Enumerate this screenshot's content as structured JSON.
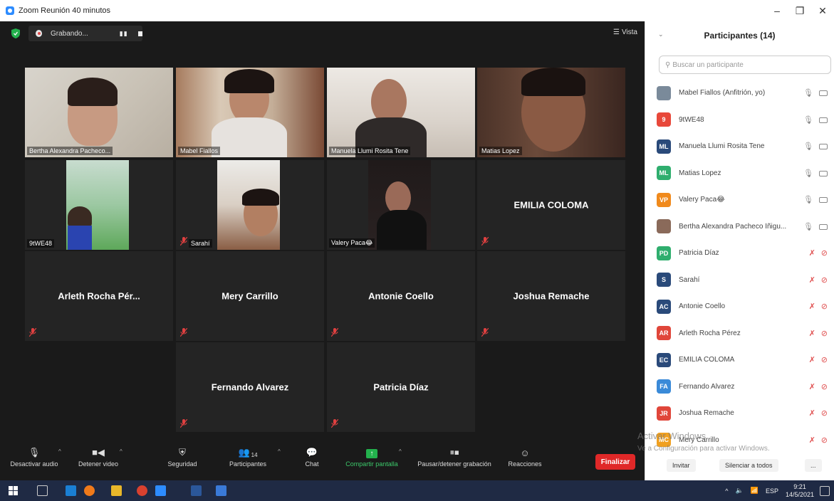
{
  "window": {
    "title": "Zoom Reunión 40 minutos",
    "minimize": "–",
    "restore": "❐",
    "close": "✕"
  },
  "recording": {
    "label": "Grabando...",
    "pause": "▮▮"
  },
  "view": {
    "label": "Vista"
  },
  "tiles": [
    {
      "label": "Bertha Alexandra Pacheco..."
    },
    {
      "label": "Mabel Fiallos"
    },
    {
      "label": "Manuela Llumi Rosita Tene"
    },
    {
      "label": "Matias Lopez"
    },
    {
      "label": "9tWE48"
    },
    {
      "label": "Sarahí"
    },
    {
      "label": "Valery Paca😂"
    },
    {
      "name": "EMILIA COLOMA"
    },
    {
      "name": "Arleth Rocha Pér..."
    },
    {
      "name": "Mery Carrillo"
    },
    {
      "name": "Antonie Coello"
    },
    {
      "name": "Joshua Remache"
    },
    {
      "name": "Fernando Alvarez"
    },
    {
      "name": "Patricia Díaz"
    }
  ],
  "toolbar": {
    "audio": "Desactivar audio",
    "video": "Detener video",
    "security": "Seguridad",
    "participants": "Participantes",
    "participants_count": "14",
    "chat": "Chat",
    "share": "Compartir pantalla",
    "pause_rec": "Pausar/detener grabación",
    "reactions": "Reacciones",
    "end": "Finalizar"
  },
  "panel": {
    "title": "Participantes (14)",
    "search_placeholder": "Buscar un participante",
    "participants": [
      {
        "name": "Mabel Fiallos (Anfitrión, yo)",
        "initials": "",
        "color": "#7a8a9a",
        "muted": false
      },
      {
        "name": "9tWE48",
        "initials": "9",
        "color": "#e8483a",
        "muted": false
      },
      {
        "name": "Manuela Llumi Rosita Tene",
        "initials": "ML",
        "color": "#2a4a7a",
        "muted": false
      },
      {
        "name": "Matias Lopez",
        "initials": "ML",
        "color": "#2fae6e",
        "muted": false
      },
      {
        "name": "Valery Paca😂",
        "initials": "VP",
        "color": "#f08a1c",
        "muted": false
      },
      {
        "name": "Bertha Alexandra Pacheco Íñigu...",
        "initials": "",
        "color": "#8a6a5a",
        "muted": false
      },
      {
        "name": "Patricia Díaz",
        "initials": "PD",
        "color": "#2fae6e",
        "muted": true
      },
      {
        "name": "Sarahí",
        "initials": "S",
        "color": "#2a4a7a",
        "muted": true
      },
      {
        "name": "Antonie Coello",
        "initials": "AC",
        "color": "#2a4a7a",
        "muted": true
      },
      {
        "name": "Arleth Rocha Pérez",
        "initials": "AR",
        "color": "#e0463a",
        "muted": true
      },
      {
        "name": "EMILIA COLOMA",
        "initials": "EC",
        "color": "#2a4a7a",
        "muted": true
      },
      {
        "name": "Fernando Alvarez",
        "initials": "FA",
        "color": "#3a8ad8",
        "muted": true
      },
      {
        "name": "Joshua Remache",
        "initials": "JR",
        "color": "#e0463a",
        "muted": true
      },
      {
        "name": "Mery Carrillo",
        "initials": "MC",
        "color": "#f0a020",
        "muted": true
      }
    ],
    "invite": "Invitar",
    "mute_all": "Silenciar a todos",
    "more": "..."
  },
  "activation": {
    "line1": "Activar Windows",
    "line2": "Ve a Configuración para activar Windows."
  },
  "taskbar": {
    "lang": "ESP",
    "time": "9:21",
    "date": "14/5/2021"
  }
}
